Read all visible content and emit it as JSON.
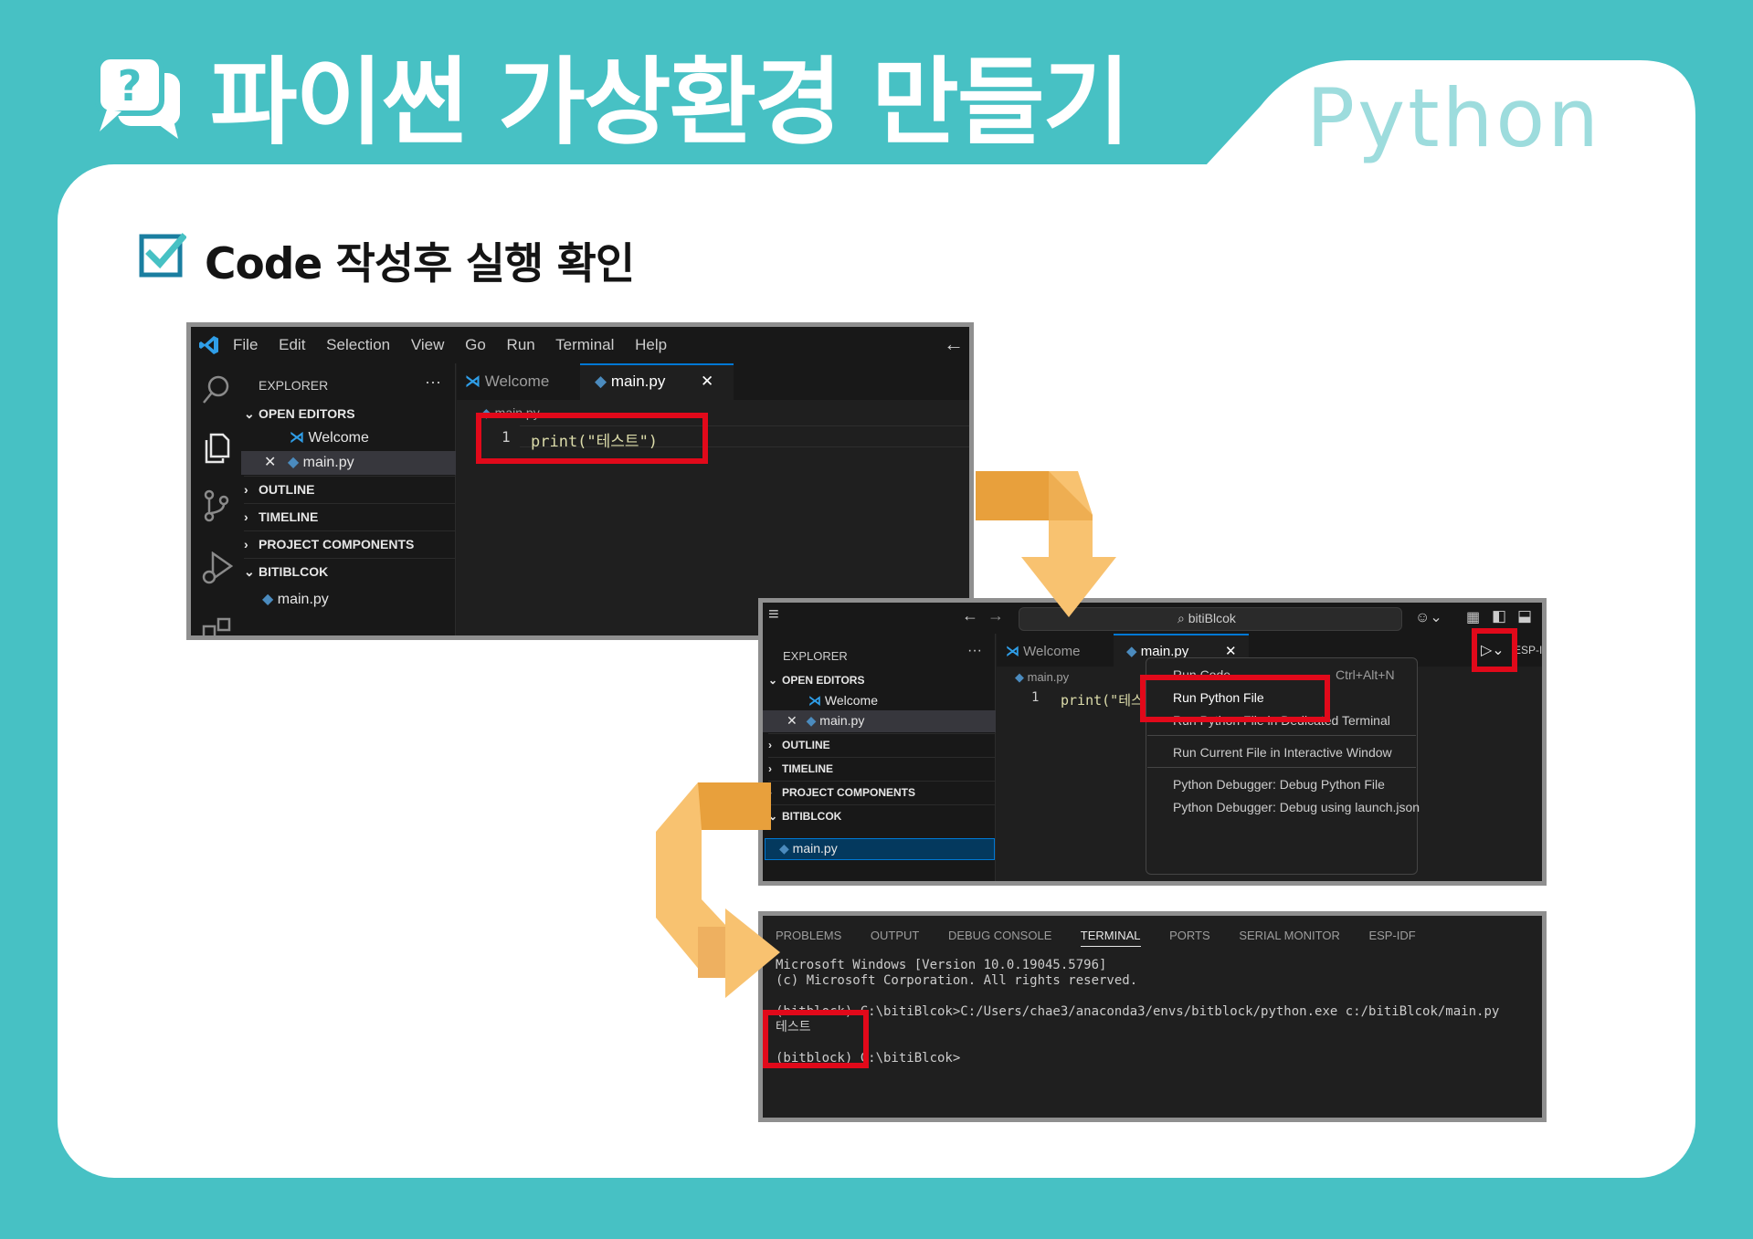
{
  "header": {
    "title": "파이썬 가상환경 만들기",
    "tag": "Python",
    "section_title": "Code 작성후 실행 확인"
  },
  "colors": {
    "background": "#47c1c4",
    "card": "#ffffff",
    "highlight": "#e1091a",
    "arrow_orange": "#e8a03c",
    "arrow_light": "#f8c270"
  },
  "vscode1": {
    "menu": [
      "File",
      "Edit",
      "Selection",
      "View",
      "Go",
      "Run",
      "Terminal",
      "Help"
    ],
    "explorer_label": "EXPLORER",
    "open_editors_label": "OPEN EDITORS",
    "open_editors": [
      {
        "label": "Welcome",
        "icon": "vscode-icon"
      },
      {
        "label": "main.py",
        "icon": "python-icon"
      }
    ],
    "sections": [
      "OUTLINE",
      "TIMELINE",
      "PROJECT COMPONENTS",
      "BITIBLCOK"
    ],
    "folder_file": "main.py",
    "tabs": [
      {
        "label": "Welcome",
        "icon": "vscode-icon"
      },
      {
        "label": "main.py",
        "icon": "python-icon"
      }
    ],
    "breadcrumb": "main.py",
    "line_number": "1",
    "code": "print(\"테스트\")"
  },
  "vscode2": {
    "search_text": "bitiBlcok",
    "explorer_label": "EXPLORER",
    "open_editors_label": "OPEN EDITORS",
    "open_editors": [
      {
        "label": "Welcome",
        "icon": "vscode-icon"
      },
      {
        "label": "main.py",
        "icon": "python-icon"
      }
    ],
    "sections": [
      "OUTLINE",
      "TIMELINE",
      "PROJECT COMPONENTS",
      "BITIBLCOK"
    ],
    "folder_file": "main.py",
    "tabs": [
      {
        "label": "Welcome",
        "icon": "vscode-icon"
      },
      {
        "label": "main.py",
        "icon": "python-icon"
      }
    ],
    "right_tab": "ESP-I",
    "breadcrumb": "main.py",
    "line_number": "1",
    "code": "print(\"테스트",
    "run_menu": [
      {
        "label": "Run Code",
        "shortcut": "Ctrl+Alt+N"
      },
      {
        "label": "Run Python File",
        "shortcut": ""
      },
      {
        "label": "Run Python File in Dedicated Terminal",
        "shortcut": ""
      },
      {
        "label": "Run Current File in Interactive Window",
        "shortcut": ""
      },
      {
        "label": "Python Debugger: Debug Python File",
        "shortcut": ""
      },
      {
        "label": "Python Debugger: Debug using launch.json",
        "shortcut": ""
      }
    ]
  },
  "terminal": {
    "tabs": [
      "PROBLEMS",
      "OUTPUT",
      "DEBUG CONSOLE",
      "TERMINAL",
      "PORTS",
      "SERIAL MONITOR",
      "ESP-IDF"
    ],
    "active_tab": "TERMINAL",
    "lines": [
      "Microsoft Windows [Version 10.0.19045.5796]",
      "(c) Microsoft Corporation. All rights reserved.",
      "",
      "(bitblock) C:\\bitiBlcok>C:/Users/chae3/anaconda3/envs/bitblock/python.exe c:/bitiBlcok/main.py",
      "테스트",
      "",
      "(bitblock) C:\\bitiBlcok>"
    ]
  }
}
